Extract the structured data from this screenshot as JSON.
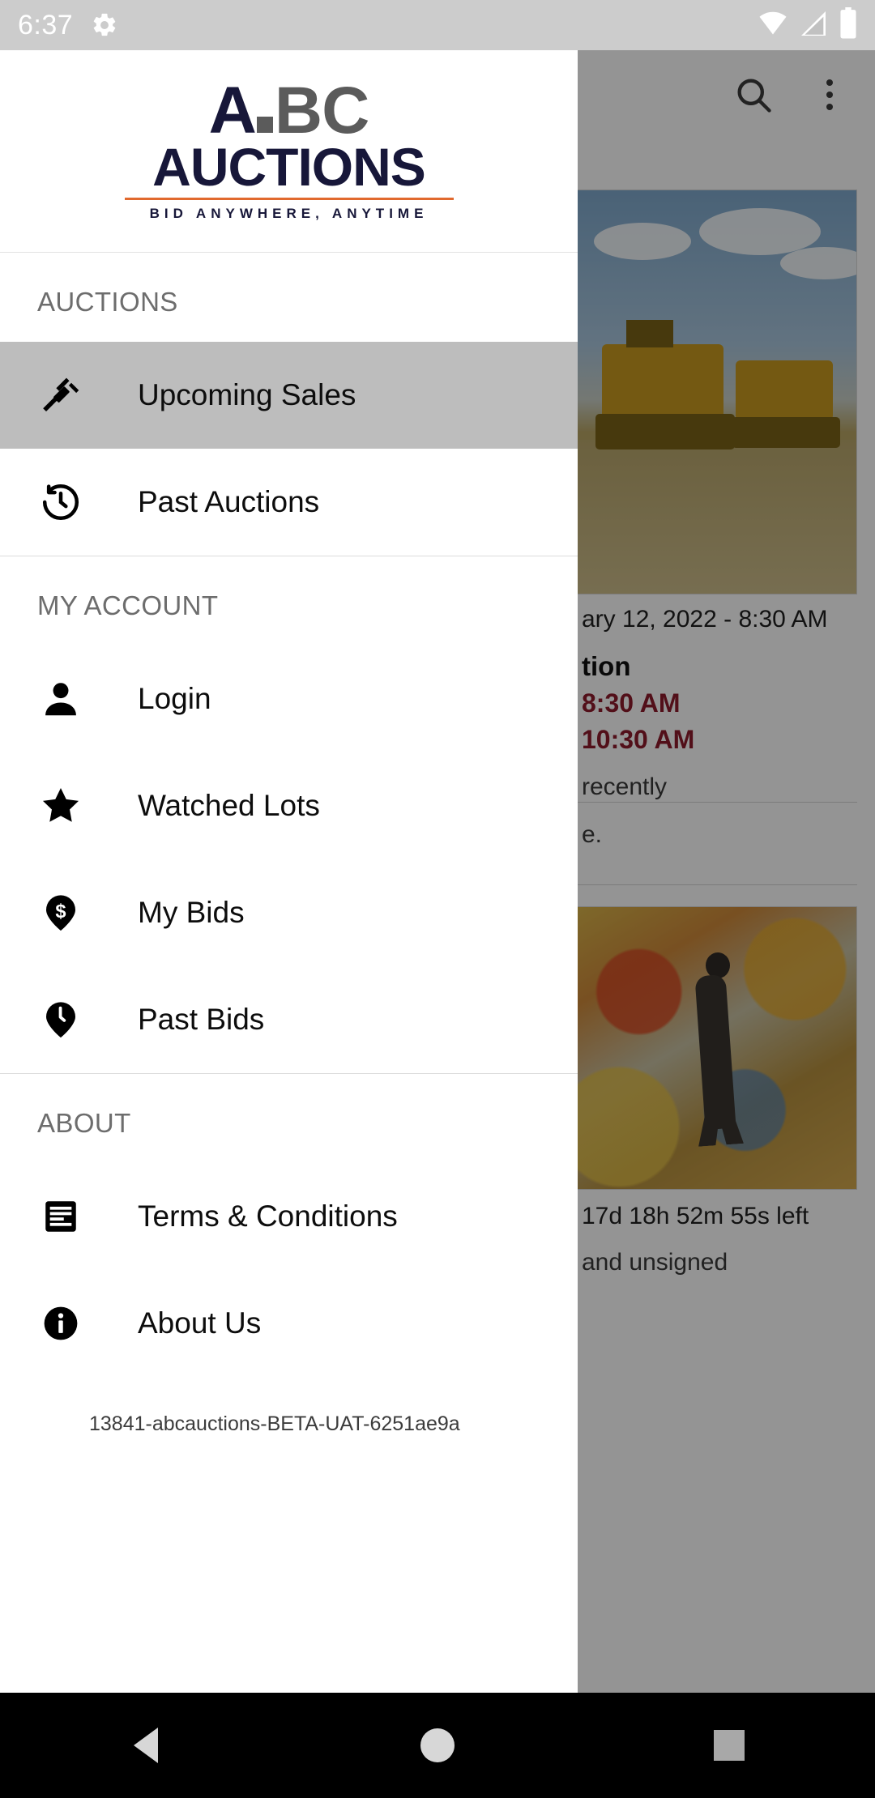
{
  "status_bar": {
    "time": "6:37",
    "icons": [
      "gear-icon",
      "wifi-icon",
      "cellular-signal-icon",
      "battery-icon"
    ]
  },
  "app_toolbar": {
    "search_icon": "search-icon",
    "overflow_icon": "more-vert-icon"
  },
  "background_content": {
    "card_1": {
      "date": "ary 12, 2022 - 8:30 AM",
      "title": "tion",
      "time_1": "8:30 AM",
      "time_2": "10:30 AM",
      "desc_1": "recently",
      "desc_2": "e."
    },
    "card_2": {
      "time_left": "17d 18h 52m 55s left",
      "desc": "and unsigned"
    }
  },
  "drawer": {
    "logo": {
      "letter_a": "A",
      "letters_bc": "BC",
      "word": "AUCTIONS",
      "tagline": "BID ANYWHERE, ANYTIME",
      "navy": "#171739",
      "gray": "#5b5b5b",
      "orange_rule": "#e1692e"
    },
    "sections": [
      {
        "header": "AUCTIONS",
        "items": [
          {
            "label": "Upcoming Sales",
            "icon": "gavel-icon",
            "active": true
          },
          {
            "label": "Past Auctions",
            "icon": "history-icon",
            "active": false
          }
        ]
      },
      {
        "header": "MY ACCOUNT",
        "items": [
          {
            "label": "Login",
            "icon": "person-icon",
            "active": false
          },
          {
            "label": "Watched Lots",
            "icon": "star-icon",
            "active": false
          },
          {
            "label": "My Bids",
            "icon": "dollar-pin-icon",
            "active": false
          },
          {
            "label": "Past Bids",
            "icon": "clock-pin-icon",
            "active": false
          }
        ]
      },
      {
        "header": "ABOUT",
        "items": [
          {
            "label": "Terms & Conditions",
            "icon": "article-icon",
            "active": false
          },
          {
            "label": "About Us",
            "icon": "info-icon",
            "active": false
          }
        ]
      }
    ],
    "version": "13841-abcauctions-BETA-UAT-6251ae9a",
    "active_highlight_color": "#bdbdbd"
  },
  "nav_bar": {
    "back": "back-triangle-icon",
    "home": "home-circle-icon",
    "recents": "recents-square-icon"
  }
}
